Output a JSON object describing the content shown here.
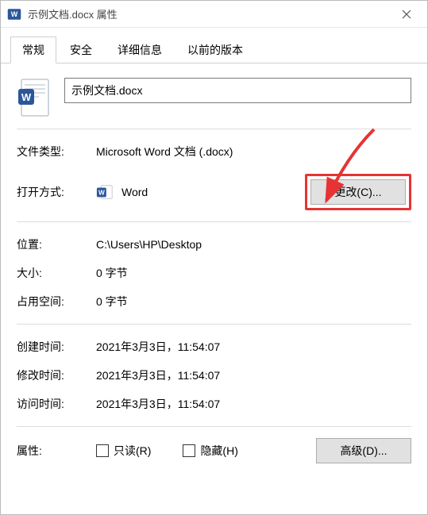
{
  "title": "示例文档.docx 属性",
  "tabs": {
    "general": "常规",
    "security": "安全",
    "details": "详细信息",
    "previous": "以前的版本"
  },
  "filename": "示例文档.docx",
  "labels": {
    "file_type": "文件类型:",
    "opens_with": "打开方式:",
    "location": "位置:",
    "size": "大小:",
    "size_on_disk": "占用空间:",
    "created": "创建时间:",
    "modified": "修改时间:",
    "accessed": "访问时间:",
    "attributes": "属性:"
  },
  "values": {
    "file_type": "Microsoft Word 文档 (.docx)",
    "opens_with": "Word",
    "location": "C:\\Users\\HP\\Desktop",
    "size": "0 字节",
    "size_on_disk": "0 字节",
    "created": "2021年3月3日，11:54:07",
    "modified": "2021年3月3日，11:54:07",
    "accessed": "2021年3月3日，11:54:07"
  },
  "buttons": {
    "change": "更改(C)...",
    "advanced": "高级(D)..."
  },
  "checkboxes": {
    "readonly": "只读(R)",
    "hidden": "隐藏(H)"
  }
}
